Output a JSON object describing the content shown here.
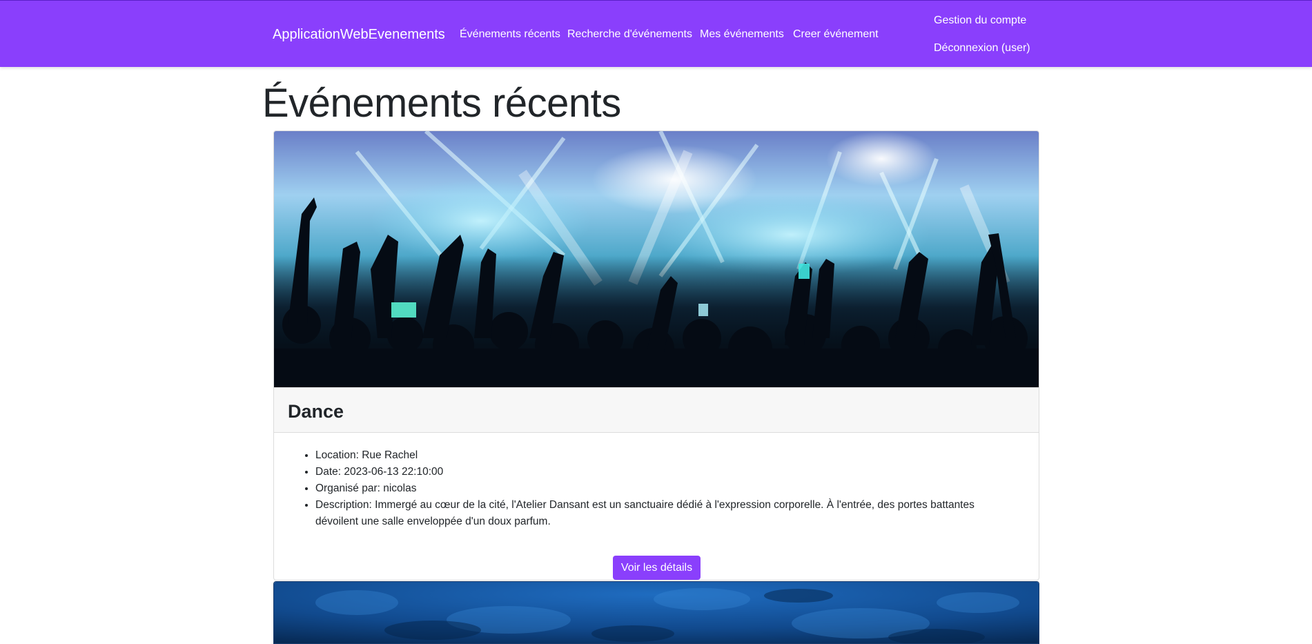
{
  "navbar": {
    "brand": "ApplicationWebEvenements",
    "links": [
      {
        "label": "Événements récents"
      },
      {
        "label": "Recherche d'événements"
      },
      {
        "label": "Mes événements"
      },
      {
        "label": "Creer événement"
      }
    ],
    "account": {
      "manage_label": "Gestion du compte",
      "logout_label": "Déconnexion (user)"
    },
    "color": "#8a3ffc"
  },
  "page": {
    "title": "Événements récents"
  },
  "events": [
    {
      "title": "Dance",
      "details": [
        "Location: Rue Rachel",
        "Date: 2023-06-13 22:10:00",
        "Organisé par: nicolas",
        "Description: Immergé au cœur de la cité, l'Atelier Dansant est un sanctuaire dédié à l'expression corporelle. À l'entrée, des portes battantes dévoilent une salle enveloppée d'un doux parfum."
      ],
      "button_label": "Voir les détails",
      "image": "concert-crowd-image"
    },
    {
      "image": "blue-textured-background-image"
    }
  ]
}
